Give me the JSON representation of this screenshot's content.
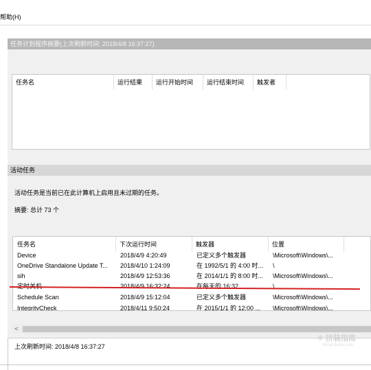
{
  "menu": {
    "help": "帮助(H)"
  },
  "summary": {
    "header": "任务计划程序摘要(上次刷新时间: 2018/4/8 16:37:27)",
    "columns": [
      "任务名",
      "运行结果",
      "运行开始时间",
      "运行结束时间",
      "触发者"
    ]
  },
  "active": {
    "header": "活动任务",
    "description": "活动任务是当前已在此计算机上启用且未过期的任务。",
    "summary_text": "摘要: 总计 73 个",
    "columns": [
      "任务名",
      "下次运行时间",
      "触发器",
      "位置"
    ],
    "rows": [
      {
        "name": "Device",
        "next": "2018/4/9 4:20:49",
        "trigger": "已定义多个触发器",
        "location": "\\Microsoft\\Windows\\..."
      },
      {
        "name": "OneDrive Standalone Update T...",
        "next": "2018/4/10 1:24:09",
        "trigger": "在 1992/5/1 的 4:00 时...",
        "location": "\\"
      },
      {
        "name": "sih",
        "next": "2018/4/9 12:53:36",
        "trigger": "在 2014/1/1 的 8:00 时...",
        "location": "\\Microsoft\\Windows\\..."
      },
      {
        "name": "定时关机",
        "next": "2018/4/9 16:32:24",
        "trigger": "在每天的 16:32",
        "location": "\\"
      },
      {
        "name": "Schedule Scan",
        "next": "2018/4/9 15:12:04",
        "trigger": "已定义多个触发器",
        "location": "\\Microsoft\\Windows\\..."
      },
      {
        "name": "IntegrityCheck",
        "next": "2018/4/11 9:50:24",
        "trigger": "在 2015/1/1 的 12:00 ...",
        "location": "\\Microsoft\\Windows\\..."
      }
    ]
  },
  "footer": {
    "last_refresh": "上次刷新时间: 2018/4/8 16:37:27"
  },
  "watermark": {
    "main": "⑤ 拼装指南",
    "sub": "shouji.baidu.com"
  },
  "scroll_left": "<"
}
